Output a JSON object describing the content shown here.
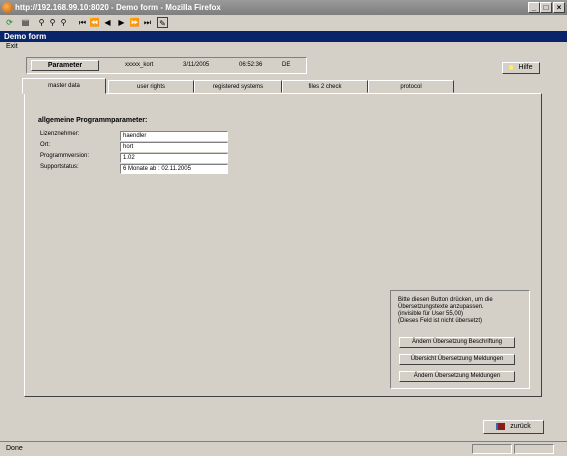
{
  "window": {
    "title": "http://192.168.99.10:8020 - Demo form - Mozilla Firefox"
  },
  "app": {
    "title": "Demo form",
    "menu_exit": "Exit"
  },
  "infobar": {
    "parameter_button": "Parameter",
    "user": "xxxxx_kort",
    "date": "3/11/2005",
    "time": "06:52:36",
    "lang": "DE",
    "help_button": "Hilfe"
  },
  "tabs": [
    {
      "label": "master data"
    },
    {
      "label": "user rights"
    },
    {
      "label": "registered systems"
    },
    {
      "label": "files 2 check"
    },
    {
      "label": "protocol"
    }
  ],
  "form": {
    "title": "allgemeine Programmparameter:",
    "fields": [
      {
        "label": "Lizenznehmer:",
        "value": "haendler"
      },
      {
        "label": "Ort:",
        "value": "hort"
      },
      {
        "label": "Programmversion:",
        "value": "1.02"
      },
      {
        "label": "Supportstatus:",
        "value": "6 Monate ab : 02.11.2005"
      }
    ]
  },
  "translation": {
    "text": [
      "Bitte diesen Button drücken, um die",
      "Übersetzungstexte anzupassen.",
      "(invisible für User 55,00)",
      "(Dieses Feld ist nicht übersetzt)"
    ],
    "buttons": [
      "Ändern Übersetzung Beschriftung",
      "Übersicht Übersetzung Meldungen",
      "Ändern Übersetzung Meldungen"
    ]
  },
  "back_button": "zurück",
  "status": "Done"
}
